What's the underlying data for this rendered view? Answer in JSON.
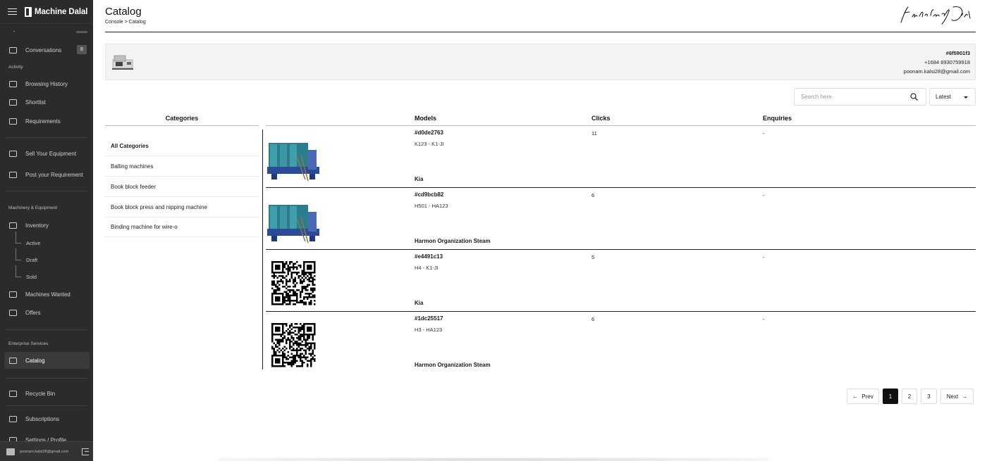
{
  "app": {
    "brand": "Machine Dalal"
  },
  "sidebar": {
    "items": [
      {
        "label": "Conversations",
        "badge": "8"
      },
      {
        "label": "Browsing History"
      },
      {
        "label": "Shortlist"
      },
      {
        "label": "Requirements"
      },
      {
        "label": "Sell Your Equipment"
      },
      {
        "label": "Post your Requirement"
      },
      {
        "label": "Inventory"
      },
      {
        "label": "Machines Wanted"
      },
      {
        "label": "Offers"
      },
      {
        "label": "Catalog"
      },
      {
        "label": "Recycle Bin"
      },
      {
        "label": "Subscriptions"
      },
      {
        "label": "Settings / Profile"
      }
    ],
    "sections": {
      "activity": "Activity",
      "machinery": "Machinery & Equipment",
      "enterprise": "Enterprise Services"
    },
    "inventory_sub": [
      "Active",
      "Draft",
      "Sold"
    ],
    "footer_email": "poonam.kalsi28@gmail.com"
  },
  "header": {
    "title": "Catalog",
    "breadcrumb": "Console > Catalog"
  },
  "info": {
    "id": "#6f5901f3",
    "phone": "+1684 8930759918",
    "email": "poonam.kalsi28@gmail.com"
  },
  "search": {
    "placeholder": "Search here"
  },
  "sort": {
    "selected": "Latest"
  },
  "categories": {
    "heading": "Categories",
    "items": [
      "All Categories",
      "Balling machines",
      "Book block feeder",
      "Book block press and nipping machine",
      "Binding machine for wire-o"
    ]
  },
  "table": {
    "headers": {
      "models": "Models",
      "clicks": "Clicks",
      "enquiries": "Enquiries"
    },
    "rows": [
      {
        "id": "#d0de2763",
        "model": "K123 - K1-JI",
        "brand": "Kia",
        "clicks": "11",
        "enquiries": "-",
        "thumb": "machine"
      },
      {
        "id": "#cd9bcb82",
        "model": "H501 - HA123",
        "brand": "Harmon Organization Steam",
        "clicks": "6",
        "enquiries": "-",
        "thumb": "machine"
      },
      {
        "id": "#e4491c13",
        "model": "H4 - K1-JI",
        "brand": "Kia",
        "clicks": "5",
        "enquiries": "-",
        "thumb": "qr"
      },
      {
        "id": "#1dc25517",
        "model": "H3 - HA123",
        "brand": "Harmon Organization Steam",
        "clicks": "6",
        "enquiries": "-",
        "thumb": "qr"
      }
    ]
  },
  "pagination": {
    "prev": "Prev",
    "pages": [
      "1",
      "2",
      "3"
    ],
    "next": "Next",
    "current": "1"
  },
  "colors": {
    "sidebar_bg": "#2b2b2b",
    "accent": "#111111"
  }
}
